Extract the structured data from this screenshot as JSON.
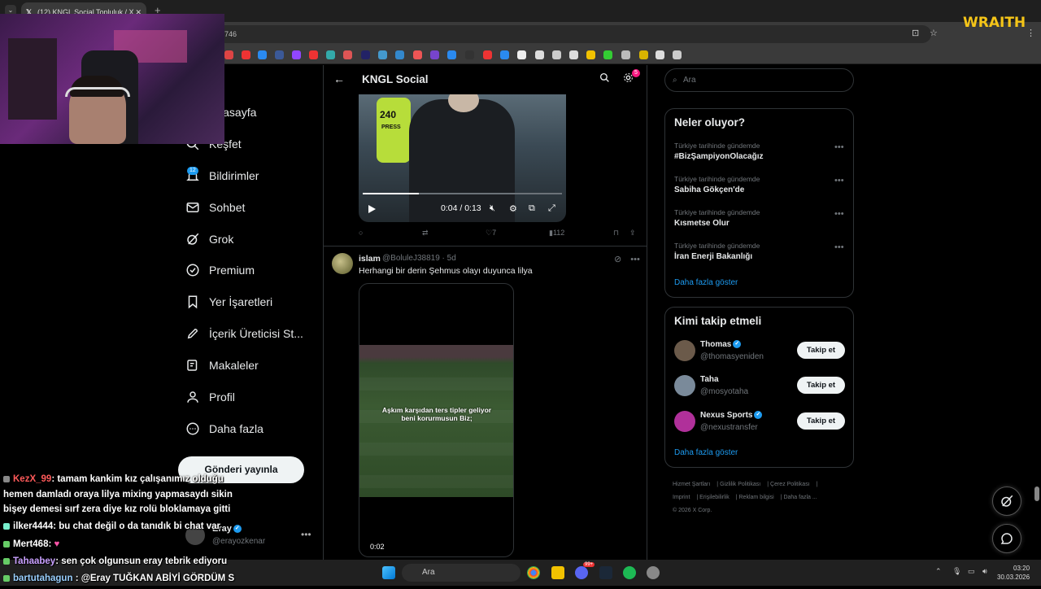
{
  "browser": {
    "tab_title": "(12) KNGL Social Topluluk / X",
    "tab_close": "✕",
    "new_tab": "+",
    "url_fragment": "746",
    "overlay_logo": "WRAITH"
  },
  "nav": {
    "items": [
      {
        "label": "Anasayfa"
      },
      {
        "label": "Keşfet"
      },
      {
        "label": "Bildirimler",
        "badge": "12"
      },
      {
        "label": "Sohbet"
      },
      {
        "label": "Grok"
      },
      {
        "label": "Premium"
      },
      {
        "label": "Yer İşaretleri"
      },
      {
        "label": "İçerik Üreticisi St..."
      },
      {
        "label": "Makaleler"
      },
      {
        "label": "Profil"
      },
      {
        "label": "Daha fazla"
      }
    ],
    "post_button": "Gönderi yayınla",
    "account_name": "Eray",
    "account_handle": "@erayozkenar"
  },
  "main": {
    "title": "KNGL Social",
    "settings_badge": "5",
    "video1": {
      "time": "0:04 / 0:13",
      "press_number": "240",
      "press_text": "PRESS",
      "progress": 0.28
    },
    "post1_actions": {
      "likes": "7",
      "views": "112"
    },
    "post2": {
      "name": "islam",
      "handle": "@BoluleJ38819 · 5d",
      "text": "Herhangi bir derin Şehmus olayı duyunca lilya",
      "caption": "Aşkım karşıdan ters tipler geliyor beni korurmusun Biz;",
      "video_time": "0:02"
    }
  },
  "right": {
    "search_placeholder": "Ara",
    "trends_title": "Neler oluyor?",
    "trends": [
      {
        "meta": "Türkiye tarihinde gündemde",
        "title": "#BizŞampiyonOlacağız"
      },
      {
        "meta": "Türkiye tarihinde gündemde",
        "title": "Sabiha Gökçen'de"
      },
      {
        "meta": "Türkiye tarihinde gündemde",
        "title": "Kısmetse Olur"
      },
      {
        "meta": "Türkiye tarihinde gündemde",
        "title": "İran Enerji Bakanlığı"
      }
    ],
    "show_more": "Daha fazla göster",
    "follow_title": "Kimi takip etmeli",
    "follow": [
      {
        "name": "Thomas",
        "handle": "@thomasyeniden",
        "verified": true,
        "button": "Takip et",
        "color": "#6b5a4a"
      },
      {
        "name": "Taha",
        "handle": "@mosyotaha",
        "verified": false,
        "button": "Takip et",
        "color": "#7a8a9a"
      },
      {
        "name": "Nexus Sports",
        "handle": "@nexustransfer",
        "verified": true,
        "button": "Takip et",
        "color": "#b0309a"
      }
    ],
    "footer": {
      "line1": [
        "Hizmet Şartları",
        "Gizlilik Politikası",
        "Çerez Politikası"
      ],
      "line2": [
        "Imprint",
        "Erişilebilirlik",
        "Reklam bilgisi",
        "Daha fazla ..."
      ],
      "copyright": "© 2026 X Corp."
    }
  },
  "chat": [
    {
      "user": "KezX_99",
      "text": ": tamam kankim kız çalışanımız olduğu",
      "color": "#ff5a5a"
    },
    {
      "user": "",
      "text": "hemen damladı oraya lilya mixing yapmasaydı sikin",
      "color": "#ffffff"
    },
    {
      "user": "",
      "text": "bişey demesi sırf zera diye kız rolü bloklamaya gitti",
      "color": "#ffffff"
    },
    {
      "user": "ilker4444",
      "text": ": bu chat değil o da tanıdık bi chat var",
      "color": "#ffffff"
    },
    {
      "user": "Mert468",
      "text": ":",
      "color": "#ffffff"
    },
    {
      "user": "Tahaabey",
      "text": ": sen çok olgunsun eray tebrik ediyoru",
      "color": "#c9a0ff"
    },
    {
      "user": "bartutahagun",
      "text": ": @Eray TUĞKAN ABİYİ GÖRDÜM S",
      "color": "#9ad0ff"
    }
  ],
  "taskbar": {
    "search": "Ara",
    "time": "03:20",
    "date": "30.03.2026",
    "badge": "99+"
  }
}
